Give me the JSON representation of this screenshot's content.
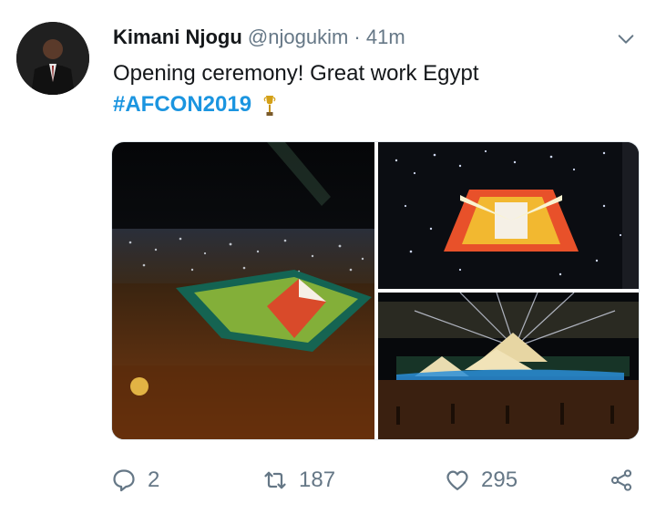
{
  "tweet": {
    "display_name": "Kimani Njogu",
    "handle": "@njogukim",
    "separator": "·",
    "time": "41m",
    "text": "Opening ceremony! Great work Egypt",
    "hashtag": "#AFCON2019"
  },
  "actions": {
    "reply_count": "2",
    "retweet_count": "187",
    "like_count": "295"
  },
  "icons": {
    "menu": "chevron-down-icon",
    "reply": "reply-icon",
    "retweet": "retweet-icon",
    "like": "heart-icon",
    "share": "share-icon",
    "emoji": "trophy-icon"
  },
  "colors": {
    "link": "#1b95e0",
    "muted": "#657786",
    "text": "#14171a"
  }
}
